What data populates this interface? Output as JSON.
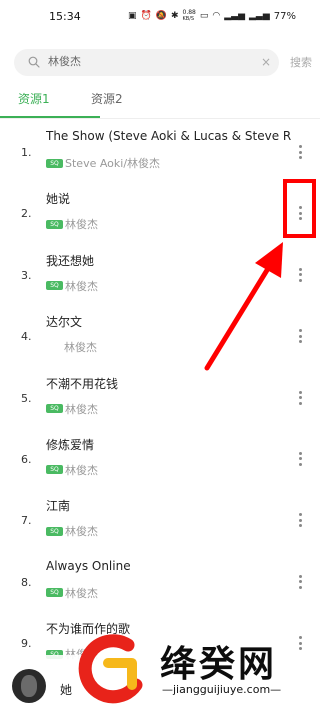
{
  "status_bar": {
    "time": "15:34",
    "network_speed": "0.88",
    "network_unit": "KB/S",
    "battery": "77%"
  },
  "search": {
    "query": "林俊杰",
    "button_label": "搜索"
  },
  "tabs": [
    {
      "label": "资源1",
      "active": true
    },
    {
      "label": "资源2",
      "active": false
    }
  ],
  "quality_badge": "SQ",
  "songs": [
    {
      "index": "1.",
      "title": "The Show (Steve Aoki & Lucas & Steve Re...",
      "artist": "Steve Aoki/林俊杰",
      "has_badge": true
    },
    {
      "index": "2.",
      "title": "她说",
      "artist": "林俊杰",
      "has_badge": true
    },
    {
      "index": "3.",
      "title": "我还想她",
      "artist": "林俊杰",
      "has_badge": true
    },
    {
      "index": "4.",
      "title": "达尔文",
      "artist": "林俊杰",
      "has_badge": false
    },
    {
      "index": "5.",
      "title": "不潮不用花钱",
      "artist": "林俊杰",
      "has_badge": true
    },
    {
      "index": "6.",
      "title": "修炼爱情",
      "artist": "林俊杰",
      "has_badge": true
    },
    {
      "index": "7.",
      "title": "江南",
      "artist": "林俊杰",
      "has_badge": true
    },
    {
      "index": "8.",
      "title": "Always Online",
      "artist": "林俊杰",
      "has_badge": true
    },
    {
      "index": "9.",
      "title": "不为谁而作的歌",
      "artist": "林俊杰",
      "has_badge": true
    }
  ],
  "player": {
    "title": "她"
  },
  "watermark": {
    "name": "绛癸网",
    "url": "jiangguijiuye.com"
  },
  "colors": {
    "accent": "#3bb056",
    "annotation": "#ff0000"
  }
}
